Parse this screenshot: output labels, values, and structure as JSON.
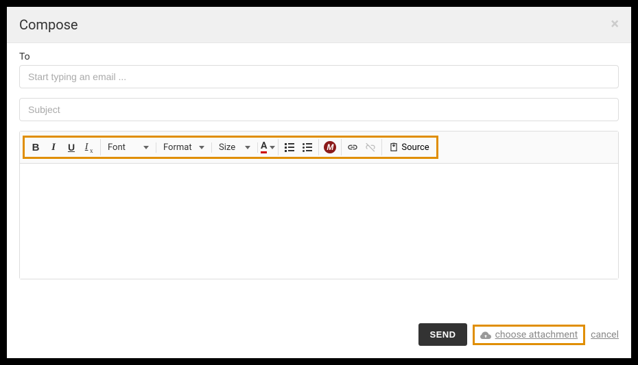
{
  "header": {
    "title": "Compose"
  },
  "fields": {
    "to_label": "To",
    "to_placeholder": "Start typing an email ...",
    "subject_placeholder": "Subject"
  },
  "toolbar": {
    "font": "Font",
    "format": "Format",
    "size": "Size",
    "source": "Source"
  },
  "footer": {
    "send": "SEND",
    "attach": "choose attachment",
    "cancel": "cancel"
  }
}
